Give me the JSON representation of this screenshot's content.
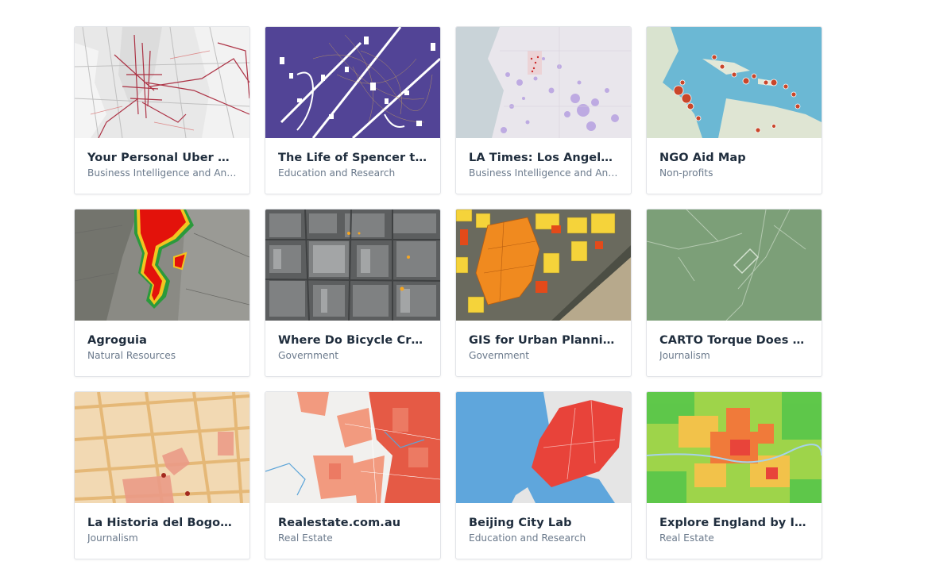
{
  "gallery": {
    "cards": [
      {
        "title": "Your Personal Uber Data Visualization",
        "category": "Business Intelligence and Analytics",
        "thumb": "uber-map-thumbnail"
      },
      {
        "title": "The Life of Spencer the Cat",
        "category": "Education and Research",
        "thumb": "spencer-cat-map-thumbnail"
      },
      {
        "title": "LA Times: Los Angeles Homicides",
        "category": "Business Intelligence and Analytics",
        "thumb": "la-times-map-thumbnail"
      },
      {
        "title": "NGO Aid Map",
        "category": "Non-profits",
        "thumb": "ngo-aid-map-thumbnail"
      },
      {
        "title": "Agroguia",
        "category": "Natural Resources",
        "thumb": "agroguia-map-thumbnail"
      },
      {
        "title": "Where Do Bicycle Crashes Happen",
        "category": "Government",
        "thumb": "bicycle-crashes-map-thumbnail"
      },
      {
        "title": "GIS for Urban Planning in Spain",
        "category": "Government",
        "thumb": "urban-planning-map-thumbnail"
      },
      {
        "title": "CARTO Torque Does Land Use",
        "category": "Journalism",
        "thumb": "torque-map-thumbnail"
      },
      {
        "title": "La Historia del Bogotazo",
        "category": "Journalism",
        "thumb": "bogotazo-map-thumbnail"
      },
      {
        "title": "Realestate.com.au",
        "category": "Real Estate",
        "thumb": "realestate-map-thumbnail"
      },
      {
        "title": "Beijing City Lab",
        "category": "Education and Research",
        "thumb": "beijing-map-thumbnail"
      },
      {
        "title": "Explore England by Illuminated Property",
        "category": "Real Estate",
        "thumb": "england-map-thumbnail"
      }
    ]
  }
}
